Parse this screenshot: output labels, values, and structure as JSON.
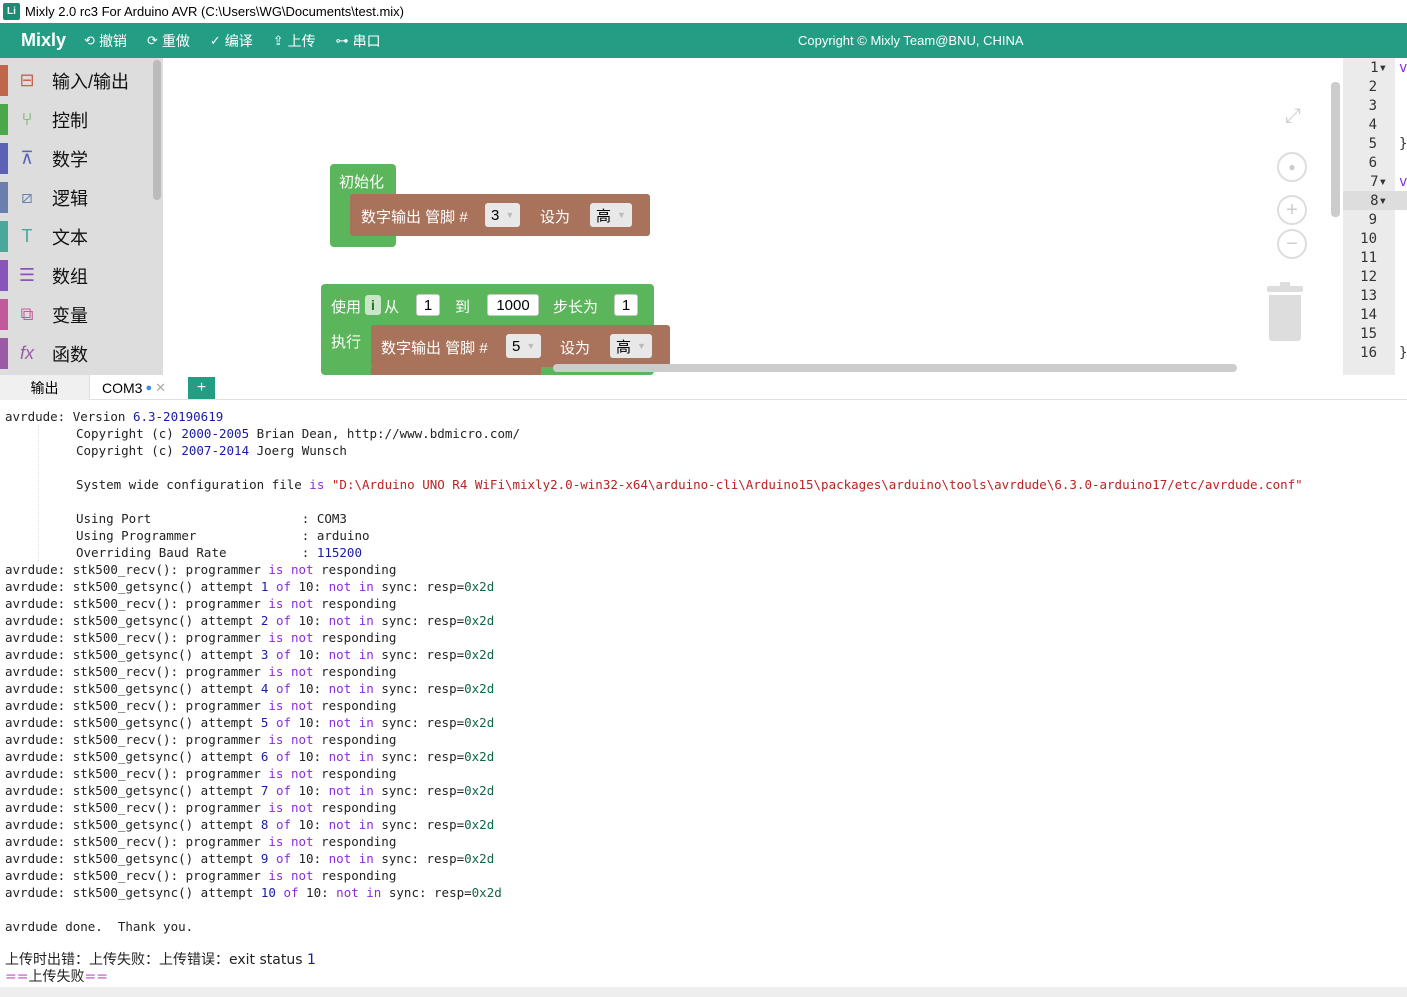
{
  "window": {
    "title": "Mixly 2.0 rc3 For Arduino AVR (C:\\Users\\WG\\Documents\\test.mix)",
    "icon_text": "Li"
  },
  "menubar": {
    "brand": "Mixly",
    "buttons": [
      {
        "icon": "undo-icon",
        "label": "撤销"
      },
      {
        "icon": "redo-icon",
        "label": "重做"
      },
      {
        "icon": "check-icon",
        "label": "编译"
      },
      {
        "icon": "upload-icon",
        "label": "上传"
      },
      {
        "icon": "usb-icon",
        "label": "串口"
      }
    ],
    "copyright": "Copyright © Mixly Team@BNU, CHINA",
    "accent": "#239e85"
  },
  "toolbox": {
    "categories": [
      {
        "label": "输入/输出",
        "icon": "io-icon",
        "color": "#c0664a"
      },
      {
        "label": "控制",
        "icon": "control-icon",
        "color": "#4aa84a"
      },
      {
        "label": "数学",
        "icon": "math-icon",
        "color": "#5b62b5"
      },
      {
        "label": "逻辑",
        "icon": "logic-icon",
        "color": "#6a7fb0"
      },
      {
        "label": "文本",
        "icon": "text-icon",
        "color": "#4aa89a"
      },
      {
        "label": "数组",
        "icon": "list-icon",
        "color": "#8a55b8"
      },
      {
        "label": "变量",
        "icon": "variable-icon",
        "color": "#c05a9a"
      },
      {
        "label": "函数",
        "icon": "function-icon",
        "color": "#9a5aa8"
      }
    ]
  },
  "blocks": {
    "setup": {
      "label": "初始化",
      "digital_write_label": "数字输出 管脚 #",
      "pin": "3",
      "set_label": "设为",
      "value": "高"
    },
    "loop": {
      "use_label": "使用",
      "var_name": "i",
      "from_label": "从",
      "from_value": "1",
      "to_label": "到",
      "to_value": "1000",
      "step_label": "步长为",
      "step_value": "1",
      "do_label": "执行",
      "digital_write_label": "数字输出 管脚 #",
      "pin": "5",
      "set_label": "设为",
      "value": "高"
    }
  },
  "code": {
    "line_numbers": [
      "1",
      "2",
      "3",
      "4",
      "5",
      "6",
      "7",
      "8",
      "9",
      "10",
      "11",
      "12",
      "13",
      "14",
      "15",
      "16"
    ],
    "fragments": {
      "1": "v",
      "5": "}",
      "7": "v",
      "16": "}"
    }
  },
  "output_tabs": {
    "tabs": [
      "输出",
      "COM3"
    ],
    "add_label": "+"
  },
  "output": {
    "header": [
      "avrdude: Version 6.3-20190619",
      "Copyright (c) 2000-2005 Brian Dean, http://www.bdmicro.com/",
      "Copyright (c) 2007-2014 Joerg Wunsch",
      "System wide configuration file is \"D:\\Arduino UNO R4 WiFi\\mixly2.0-win32-x64\\arduino-cli\\Arduino15\\packages\\arduino\\tools\\avrdude\\6.3.0-arduino17/etc/avrdude.conf\"",
      "Using Port                    : COM3",
      "Using Programmer              : arduino",
      "Overriding Baud Rate          : 115200"
    ],
    "attempts": [
      {
        "recv": "avrdude: stk500_recv(): programmer is not responding",
        "sync": "avrdude: stk500_getsync() attempt 1 of 10: not in sync: resp=0x2d"
      },
      {
        "recv": "avrdude: stk500_recv(): programmer is not responding",
        "sync": "avrdude: stk500_getsync() attempt 2 of 10: not in sync: resp=0x2d"
      },
      {
        "recv": "avrdude: stk500_recv(): programmer is not responding",
        "sync": "avrdude: stk500_getsync() attempt 3 of 10: not in sync: resp=0x2d"
      },
      {
        "recv": "avrdude: stk500_recv(): programmer is not responding",
        "sync": "avrdude: stk500_getsync() attempt 4 of 10: not in sync: resp=0x2d"
      },
      {
        "recv": "avrdude: stk500_recv(): programmer is not responding",
        "sync": "avrdude: stk500_getsync() attempt 5 of 10: not in sync: resp=0x2d"
      },
      {
        "recv": "avrdude: stk500_recv(): programmer is not responding",
        "sync": "avrdude: stk500_getsync() attempt 6 of 10: not in sync: resp=0x2d"
      },
      {
        "recv": "avrdude: stk500_recv(): programmer is not responding",
        "sync": "avrdude: stk500_getsync() attempt 7 of 10: not in sync: resp=0x2d"
      },
      {
        "recv": "avrdude: stk500_recv(): programmer is not responding",
        "sync": "avrdude: stk500_getsync() attempt 8 of 10: not in sync: resp=0x2d"
      },
      {
        "recv": "avrdude: stk500_recv(): programmer is not responding",
        "sync": "avrdude: stk500_getsync() attempt 9 of 10: not in sync: resp=0x2d"
      },
      {
        "recv": "avrdude: stk500_recv(): programmer is not responding",
        "sync": "avrdude: stk500_getsync() attempt 10 of 10: not in sync: resp=0x2d"
      }
    ],
    "done": "avrdude done.  Thank you.",
    "error": "上传时出错：上传失败：上传错误：exit status 1",
    "fail": "==上传失败=="
  }
}
